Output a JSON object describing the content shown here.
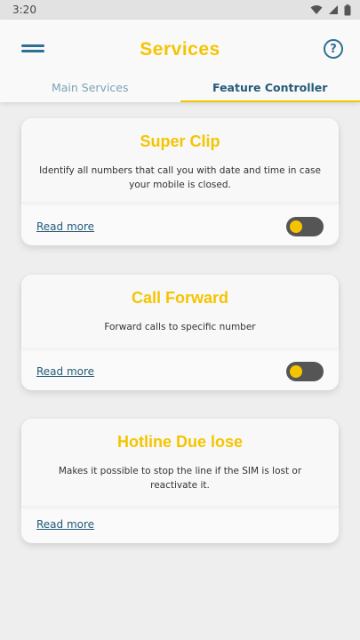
{
  "status_bar": {
    "time": "3:20"
  },
  "header": {
    "title": "Services"
  },
  "tabs": [
    {
      "label": "Main Services",
      "active": false
    },
    {
      "label": "Feature Controller",
      "active": true
    }
  ],
  "cards": [
    {
      "title": "Super Clip",
      "description": "Identify all numbers that call you with date and time in case your mobile is closed.",
      "link_label": "Read more",
      "toggle_on": false
    },
    {
      "title": "Call Forward",
      "description": "Forward calls to specific number",
      "link_label": "Read more",
      "toggle_on": false
    },
    {
      "title": "Hotline Due lose",
      "description": "Makes it possible to stop the line if the SIM is lost or reactivate it.",
      "link_label": "Read more"
    }
  ],
  "colors": {
    "accent": "#f5c400",
    "primary": "#245b78",
    "toggle_track": "#555555"
  },
  "icons": {
    "menu": "menu-icon",
    "help": "help-icon",
    "wifi": "wifi-icon",
    "signal": "signal-icon",
    "battery": "battery-icon"
  }
}
